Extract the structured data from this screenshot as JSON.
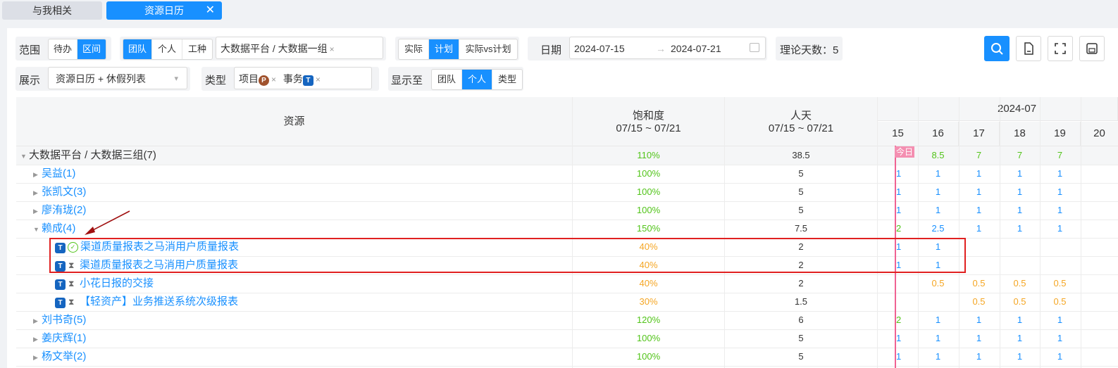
{
  "tabs": [
    {
      "label": "与我相关",
      "active": false
    },
    {
      "label": "资源日历",
      "active": true,
      "close": "✕"
    }
  ],
  "filters": {
    "scope": {
      "label": "范围",
      "options": [
        "待办",
        "区间"
      ],
      "selected": "区间"
    },
    "unit": {
      "options": [
        "团队",
        "个人",
        "工种"
      ],
      "selected": "团队",
      "value": "大数据平台 / 大数据一组",
      "value_close": "×"
    },
    "mode": {
      "options": [
        "实际",
        "计划",
        "实际vs计划"
      ],
      "selected": "计划"
    },
    "date": {
      "label": "日期",
      "start": "2024-07-15",
      "arrow": "→",
      "end": "2024-07-21"
    },
    "theory_days": "理论天数：5",
    "display": {
      "label": "展示",
      "value": "资源日历 + 休假列表"
    },
    "type": {
      "label": "类型",
      "tags": [
        {
          "text": "项目",
          "badge": "P"
        },
        {
          "text": "事务",
          "badge": "T"
        }
      ],
      "close": "×"
    },
    "show_to": {
      "label": "显示至",
      "options": [
        "团队",
        "个人",
        "类型"
      ],
      "selected": "个人"
    }
  },
  "table": {
    "col_resource": "资源",
    "col_saturation": "饱和度",
    "col_saturation_range": "07/15 ~ 07/21",
    "col_mandays": "人天",
    "col_mandays_range": "07/15 ~ 07/21",
    "month": "2024-07",
    "days": [
      "15",
      "16",
      "17",
      "18",
      "19",
      "20"
    ],
    "today_label": "今日",
    "rows": [
      {
        "kind": "group",
        "caret": "▼",
        "name": "大数据平台 / 大数据三组(7)",
        "sat": "110%",
        "sat_color": "green",
        "md": "38.5",
        "vals": [
          "",
          "8.5",
          "7",
          "7",
          "7",
          ""
        ],
        "val_color": "green"
      },
      {
        "kind": "person",
        "caret": "▶",
        "name": "吴益(1)",
        "sat": "100%",
        "sat_color": "green",
        "md": "5",
        "vals": [
          "1",
          "1",
          "1",
          "1",
          "1",
          ""
        ],
        "val_color": "blue"
      },
      {
        "kind": "person",
        "caret": "▶",
        "name": "张凯文(3)",
        "sat": "100%",
        "sat_color": "green",
        "md": "5",
        "vals": [
          "1",
          "1",
          "1",
          "1",
          "1",
          ""
        ],
        "val_color": "blue"
      },
      {
        "kind": "person",
        "caret": "▶",
        "name": "廖洧珑(2)",
        "sat": "100%",
        "sat_color": "green",
        "md": "5",
        "vals": [
          "1",
          "1",
          "1",
          "1",
          "1",
          ""
        ],
        "val_color": "blue"
      },
      {
        "kind": "person",
        "caret": "▼",
        "name": "赖成(4)",
        "sat": "150%",
        "sat_color": "green",
        "md": "7.5",
        "vals": [
          "2",
          "2.5",
          "1",
          "1",
          "1",
          ""
        ],
        "val_color": "blue",
        "first_green": true
      },
      {
        "kind": "task",
        "status": "done",
        "badge": "T",
        "name": "渠道质量报表之马消用户质量报表",
        "sat": "40%",
        "sat_color": "orange",
        "md": "2",
        "vals": [
          "1",
          "1",
          "",
          "",
          "",
          ""
        ],
        "val_color": "blue"
      },
      {
        "kind": "task",
        "status": "pending",
        "badge": "T",
        "name": "渠道质量报表之马消用户质量报表",
        "sat": "40%",
        "sat_color": "orange",
        "md": "2",
        "vals": [
          "1",
          "1",
          "",
          "",
          "",
          ""
        ],
        "val_color": "blue"
      },
      {
        "kind": "task",
        "status": "pending",
        "badge": "T",
        "name": "小花日报的交接",
        "sat": "40%",
        "sat_color": "orange",
        "md": "2",
        "vals": [
          "",
          "0.5",
          "0.5",
          "0.5",
          "0.5",
          ""
        ],
        "val_color": "orange"
      },
      {
        "kind": "task",
        "status": "pending",
        "badge": "T",
        "name": "【轻资产】业务推送系统次级报表",
        "sat": "30%",
        "sat_color": "orange",
        "md": "1.5",
        "vals": [
          "",
          "",
          "0.5",
          "0.5",
          "0.5",
          ""
        ],
        "val_color": "orange"
      },
      {
        "kind": "person",
        "caret": "▶",
        "name": "刘书奇(5)",
        "sat": "120%",
        "sat_color": "green",
        "md": "6",
        "vals": [
          "2",
          "1",
          "1",
          "1",
          "1",
          ""
        ],
        "val_color": "blue",
        "first_green": true
      },
      {
        "kind": "person",
        "caret": "▶",
        "name": "姜庆辉(1)",
        "sat": "100%",
        "sat_color": "green",
        "md": "5",
        "vals": [
          "1",
          "1",
          "1",
          "1",
          "1",
          ""
        ],
        "val_color": "blue"
      },
      {
        "kind": "person",
        "caret": "▶",
        "name": "杨文举(2)",
        "sat": "100%",
        "sat_color": "green",
        "md": "5",
        "vals": [
          "1",
          "1",
          "1",
          "1",
          "1",
          ""
        ],
        "val_color": "blue"
      }
    ]
  },
  "colors": {
    "accent": "#1890ff",
    "highlight": "#e02020",
    "today": "#f06292"
  }
}
